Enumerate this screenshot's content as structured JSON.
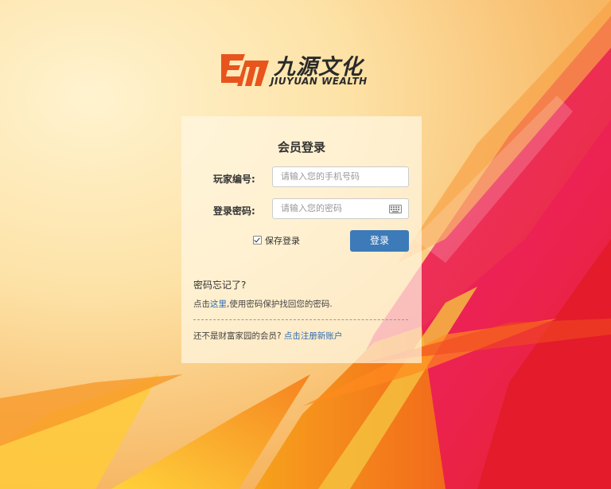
{
  "brand": {
    "name_cn": "九源文化",
    "name_en": "JIUYUAN WEALTH",
    "logo_mark_text": "EM",
    "accent_color": "#e8541c"
  },
  "login_panel": {
    "title": "会员登录",
    "player_id": {
      "label": "玩家编号:",
      "placeholder": "请输入您的手机号码",
      "value": ""
    },
    "password": {
      "label": "登录密码:",
      "placeholder": "请输入您的密码",
      "value": "",
      "icon": "keyboard-icon"
    },
    "remember": {
      "label": "保存登录",
      "checked": true
    },
    "submit_label": "登录",
    "button_color": "#3d7ab8"
  },
  "forgot": {
    "title": "密码忘记了?",
    "prefix": "点击",
    "link": "这里",
    "suffix": ",使用密码保护找回您的密码."
  },
  "register": {
    "prefix": "还不是财富家园的会员?",
    "link": "点击注册新账户"
  }
}
